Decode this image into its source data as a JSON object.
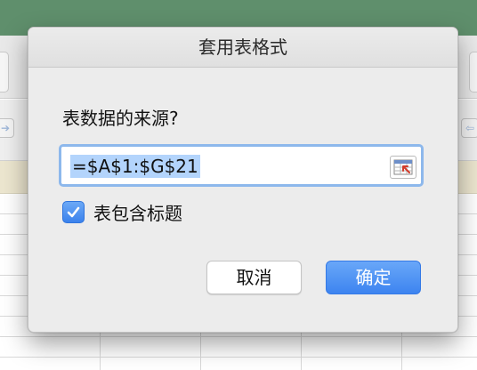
{
  "dialog": {
    "title": "套用表格式",
    "prompt": "表数据的来源?",
    "range_value": "=$A$1:$G$21",
    "collapse_icon": "range-select-icon",
    "checkbox": {
      "label": "表包含标题",
      "checked": true
    },
    "buttons": {
      "cancel": "取消",
      "ok": "确定"
    }
  },
  "colors": {
    "accent": "#3d84f0",
    "selection": "#b3d4fc",
    "focus_ring": "#8db8ec",
    "background_header": "#5f8f6c"
  }
}
